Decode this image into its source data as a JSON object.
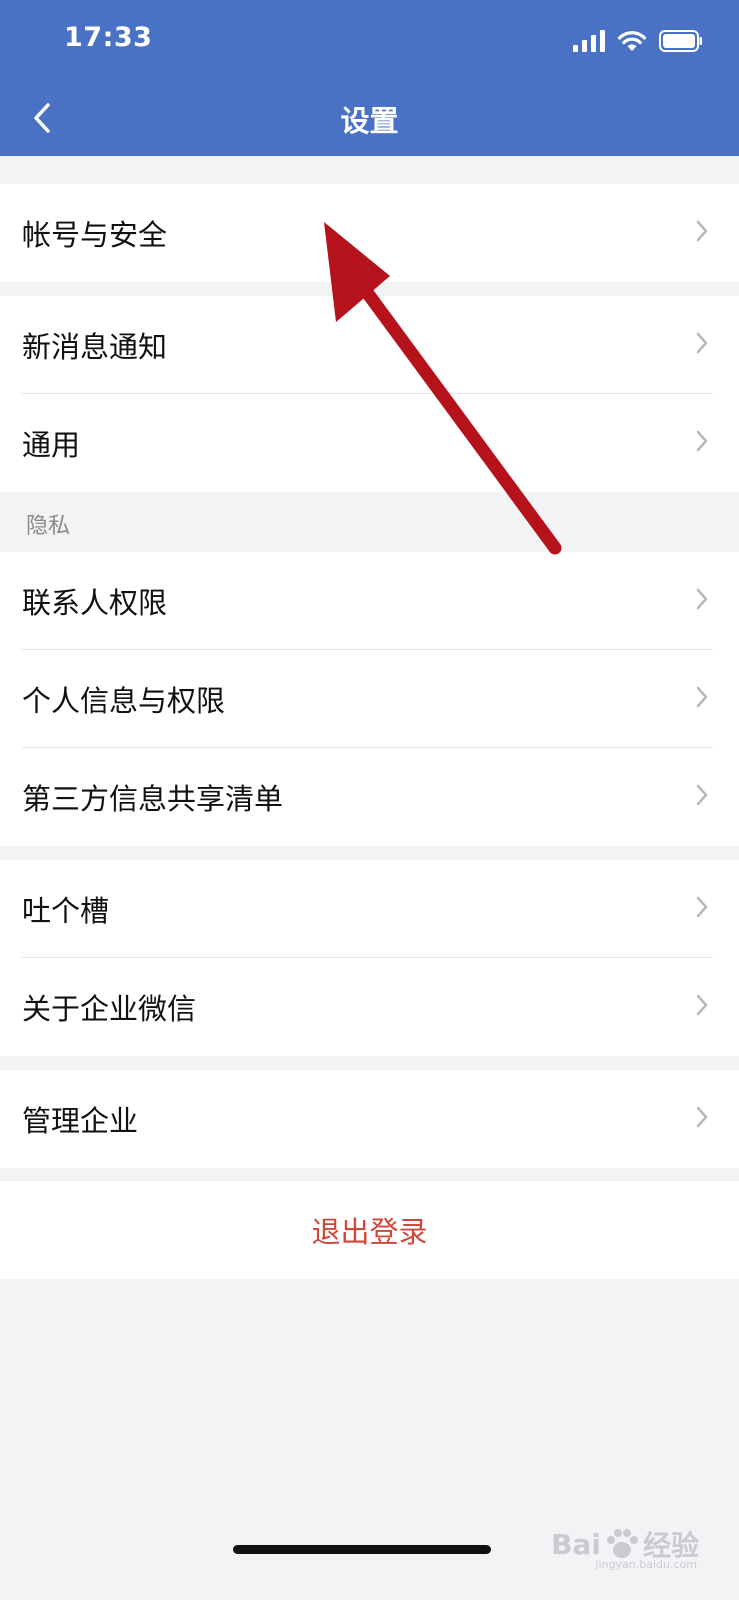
{
  "status_bar": {
    "time": "17:33",
    "icons": [
      "cellular-signal-icon",
      "wifi-icon",
      "battery-icon"
    ]
  },
  "nav": {
    "title": "设置",
    "back_icon": "chevron-left-icon"
  },
  "groups": [
    {
      "items": [
        {
          "label": "帐号与安全"
        }
      ]
    },
    {
      "items": [
        {
          "label": "新消息通知"
        },
        {
          "label": "通用"
        }
      ]
    },
    {
      "header": "隐私",
      "items": [
        {
          "label": "联系人权限"
        },
        {
          "label": "个人信息与权限"
        },
        {
          "label": "第三方信息共享清单"
        }
      ]
    },
    {
      "items": [
        {
          "label": "吐个槽"
        },
        {
          "label": "关于企业微信"
        }
      ]
    },
    {
      "items": [
        {
          "label": "管理企业"
        }
      ]
    }
  ],
  "logout": {
    "label": "退出登录"
  },
  "watermark": {
    "text": "Bai",
    "text2": "经验",
    "sub": "jingyan.baidu.com"
  },
  "colors": {
    "header_bg": "#4a72c4",
    "page_bg": "#f2f3f5",
    "logout_text": "#d0473a",
    "annotation_arrow": "#b5121b"
  }
}
